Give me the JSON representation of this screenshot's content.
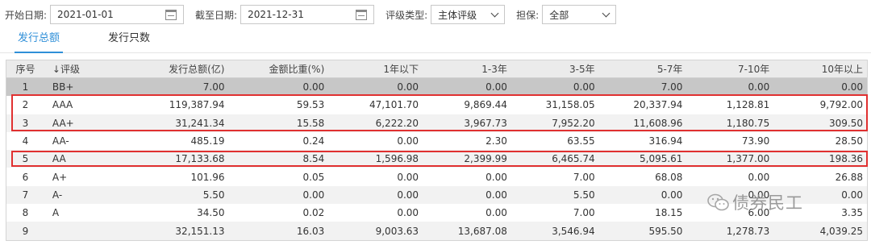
{
  "filters": {
    "start_label": "开始日期:",
    "start_value": "2021-01-01",
    "end_label": "截至日期:",
    "end_value": "2021-12-31",
    "rating_type_label": "评级类型:",
    "rating_type_value": "主体评级",
    "guarantee_label": "担保:",
    "guarantee_value": "全部"
  },
  "tabs": [
    {
      "label": "发行总额",
      "active": true
    },
    {
      "label": "发行只数",
      "active": false
    }
  ],
  "table": {
    "headers": [
      "序号",
      "↓评级",
      "发行总额(亿)",
      "金额比重(%)",
      "1年以下",
      "1-3年",
      "3-5年",
      "5-7年",
      "7-10年",
      "10年以上"
    ],
    "rows": [
      [
        "1",
        "BB+",
        "7.00",
        "0.00",
        "0.00",
        "0.00",
        "0.00",
        "7.00",
        "0.00",
        "0.00"
      ],
      [
        "2",
        "AAA",
        "119,387.94",
        "59.53",
        "47,101.70",
        "9,869.44",
        "31,158.05",
        "20,337.94",
        "1,128.81",
        "9,792.00"
      ],
      [
        "3",
        "AA+",
        "31,241.34",
        "15.58",
        "6,222.20",
        "3,967.73",
        "7,952.20",
        "11,608.96",
        "1,180.75",
        "309.50"
      ],
      [
        "4",
        "AA-",
        "485.19",
        "0.24",
        "0.00",
        "2.30",
        "63.55",
        "316.94",
        "73.90",
        "28.50"
      ],
      [
        "5",
        "AA",
        "17,133.68",
        "8.54",
        "1,596.98",
        "2,399.99",
        "6,465.74",
        "5,095.61",
        "1,377.00",
        "198.36"
      ],
      [
        "6",
        "A+",
        "101.96",
        "0.05",
        "0.00",
        "0.00",
        "7.00",
        "68.08",
        "0.00",
        "26.88"
      ],
      [
        "7",
        "A-",
        "5.50",
        "0.00",
        "0.00",
        "0.00",
        "5.50",
        "0.00",
        "0.00",
        "0.00"
      ],
      [
        "8",
        "A",
        "34.50",
        "0.02",
        "0.00",
        "0.00",
        "7.00",
        "18.15",
        "6.00",
        "3.35"
      ],
      [
        "9",
        "",
        "32,151.13",
        "16.03",
        "9,003.63",
        "13,687.08",
        "3,546.94",
        "595.50",
        "1,278.73",
        "4,039.25"
      ]
    ]
  },
  "watermark": {
    "text": "债券民工"
  },
  "colors": {
    "accent": "#2f8fd8",
    "highlight": "#e03030"
  }
}
